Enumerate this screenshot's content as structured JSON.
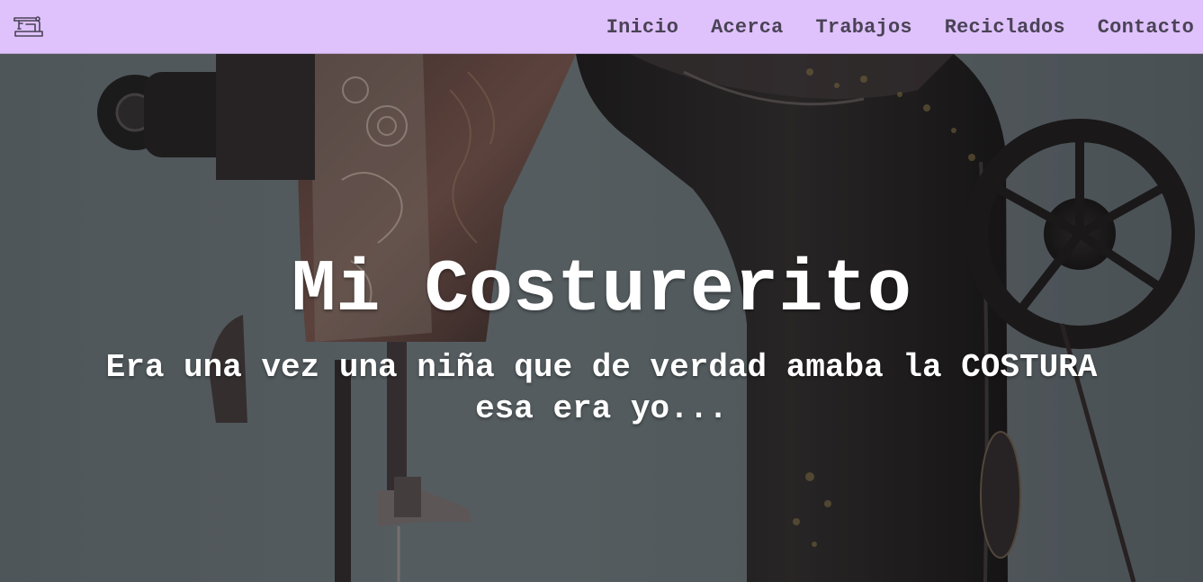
{
  "navbar": {
    "logo_icon": "sewing-machine-icon",
    "links": [
      {
        "label": "Inicio"
      },
      {
        "label": "Acerca"
      },
      {
        "label": "Trabajos"
      },
      {
        "label": "Reciclados"
      },
      {
        "label": "Contacto"
      }
    ],
    "background_color": "#dfc2fc",
    "text_color": "#4a4356"
  },
  "hero": {
    "background_image": "vintage-sewing-machine-photo",
    "title": "Mi Costurerito",
    "subtitle_line1": "Era una vez una niña que de verdad amaba la COSTURA",
    "subtitle_line2": "esa era yo...",
    "text_color": "#ffffff"
  }
}
